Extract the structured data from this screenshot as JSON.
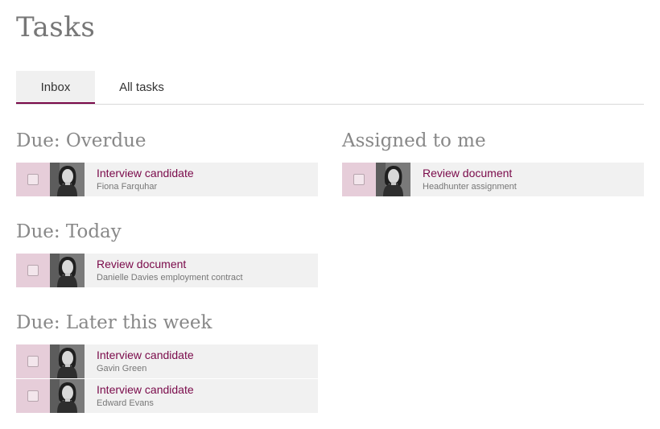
{
  "page": {
    "title": "Tasks"
  },
  "tabs": [
    {
      "label": "Inbox",
      "active": true
    },
    {
      "label": "All tasks",
      "active": false
    }
  ],
  "left_sections": [
    {
      "heading": "Due: Overdue",
      "tasks": [
        {
          "title": "Interview candidate",
          "subtitle": "Fiona Farquhar"
        }
      ]
    },
    {
      "heading": "Due: Today",
      "tasks": [
        {
          "title": "Review document",
          "subtitle": "Danielle Davies employment contract"
        }
      ]
    },
    {
      "heading": "Due: Later this week",
      "tasks": [
        {
          "title": "Interview candidate",
          "subtitle": "Gavin Green"
        },
        {
          "title": "Interview candidate",
          "subtitle": "Edward Evans"
        }
      ]
    }
  ],
  "right_sections": [
    {
      "heading": "Assigned to me",
      "tasks": [
        {
          "title": "Review document",
          "subtitle": "Headhunter assignment"
        }
      ]
    }
  ],
  "colors": {
    "accent": "#7a0a4a",
    "checkbox_cell": "#e6cdd9",
    "row_bg": "#f1f1f1"
  },
  "icons": {
    "avatar": "person-photo-avatar",
    "checkbox": "checkbox-icon"
  }
}
